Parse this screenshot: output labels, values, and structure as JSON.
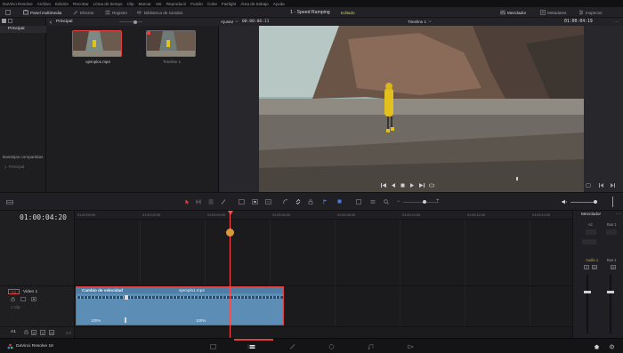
{
  "menu": [
    "DaVinci Resolve",
    "Archivo",
    "Edición",
    "Recortar",
    "Línea de tiempo",
    "Clip",
    "Marcar",
    "Ver",
    "Reproducir",
    "Fusión",
    "Color",
    "Fairlight",
    "Área de trabajo",
    "Ayuda"
  ],
  "toolbar": {
    "media_panel": "Panel multimedia",
    "effects": "Efectos",
    "index": "Registro",
    "library": "Biblioteca de sonidos",
    "project_title": "1 - Speed Ramping",
    "edited_badge": "Editado",
    "mixer": "Mezclador",
    "metadata": "Metadatos",
    "inspector": "Inspector"
  },
  "media_pool": {
    "principal_tab": "Principal",
    "sidebar_item": "Principal",
    "smart_bins_title": "Bandejas compartidas",
    "smart_bins_item": "Principal",
    "clips": [
      {
        "name": "ejemplo1.mp4"
      },
      {
        "name": "Timeline 1"
      }
    ]
  },
  "viewer": {
    "zoom": "Ajustar",
    "source_tc": "00:00:06:11",
    "timeline_name": "Timeline 1",
    "record_tc": "01:00:04:19"
  },
  "timeline": {
    "current_tc": "01:00:04:20",
    "ruler": [
      "01:00:00:00",
      "01:00:02:00",
      "01:00:04:00",
      "01:00:06:00",
      "01:00:08:00",
      "01:00:10:00",
      "01:00:12:00",
      "01:00:14:00"
    ],
    "video_track": {
      "id": "V1",
      "name": "Video 1",
      "clip_count": "1 Clip"
    },
    "audio_track": {
      "id": "A1",
      "level": "2.0"
    },
    "clip": {
      "title": "Cambio de velocidad",
      "name": "ejemplo1.mp4",
      "speed_a": "100%",
      "speed_b": "100%"
    }
  },
  "mixer": {
    "title": "Mezclador",
    "channels": [
      "A1",
      "Bus 1"
    ],
    "labels": [
      "Audio 1",
      "Bus 1"
    ]
  },
  "bottom": {
    "app": "DaVinci Resolve 18"
  },
  "colors": {
    "accent": "#e04040",
    "clip_blue": "#5b8db5",
    "edited": "#c7d24a",
    "playhead": "#ff4a4a"
  }
}
